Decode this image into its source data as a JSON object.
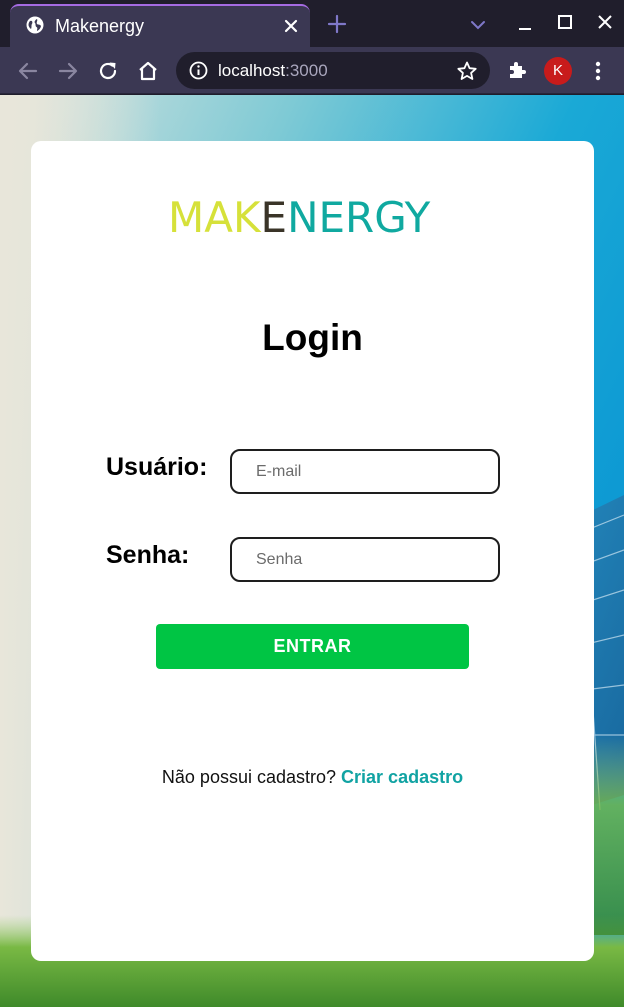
{
  "browser": {
    "tab_title": "Makenergy",
    "url_host": "localhost",
    "url_port": ":3000",
    "profile_initial": "K",
    "accent_color": "#a56be3"
  },
  "icons": [
    "globe-icon",
    "close-icon",
    "plus-icon",
    "chevron-down-icon",
    "minimize-icon",
    "maximize-icon",
    "window-close-icon",
    "back-arrow-icon",
    "forward-arrow-icon",
    "reload-icon",
    "home-icon",
    "info-icon",
    "star-icon",
    "puzzle-icon",
    "kebab-menu-icon"
  ],
  "login": {
    "logo": {
      "part1": "MAK",
      "part2": "E",
      "part3": "NERGY"
    },
    "heading": "Login",
    "user_label": "Usuário:",
    "user_placeholder": "E-mail",
    "password_label": "Senha:",
    "password_placeholder": "Senha",
    "submit_label": "ENTRAR",
    "signup_prompt": "Não possui cadastro?",
    "signup_link": "Criar cadastro",
    "colors": {
      "button": "#00c544",
      "link": "#11a3a3",
      "logo_yellow": "#d6e13a",
      "logo_teal": "#10a9a0"
    }
  }
}
